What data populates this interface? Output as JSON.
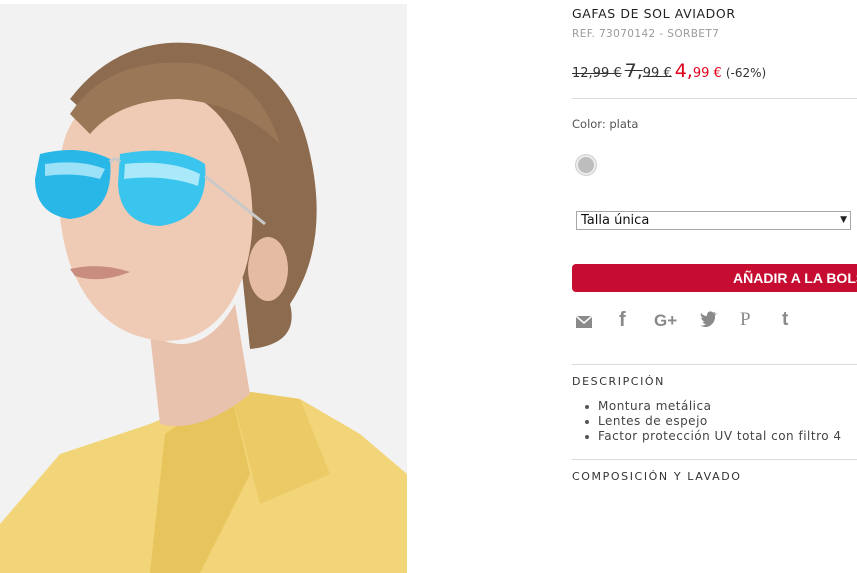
{
  "product": {
    "title": "GAFAS DE SOL AVIADOR",
    "ref": "REF. 73070142 - SORBET7",
    "price": {
      "original": "12,99 €",
      "previous_int": "7,",
      "previous_dec": "99 €",
      "current_int": "4,",
      "current_dec": "99 €",
      "discount": "(-62%)",
      "sale_color": "#e0001b"
    },
    "color_label": "Color: plata",
    "swatch_color": "#bdbdbd",
    "size_selected": "Talla única",
    "add_to_bag": "AÑADIR A LA BOLSA",
    "add_button_color": "#c60c30"
  },
  "share": {
    "icons": [
      "mail-icon",
      "facebook-icon",
      "google-plus-icon",
      "twitter-icon",
      "pinterest-icon",
      "tumblr-icon"
    ],
    "glyphs": {
      "facebook": "f",
      "google": "G+",
      "pinterest": "P",
      "tumblr": "t"
    }
  },
  "description": {
    "title": "DESCRIPCIÓN",
    "items": [
      "Montura metálica",
      "Lentes de espejo",
      "Factor protección UV total con filtro 4"
    ]
  },
  "composition": {
    "title": "COMPOSICIÓN Y LAVADO"
  }
}
